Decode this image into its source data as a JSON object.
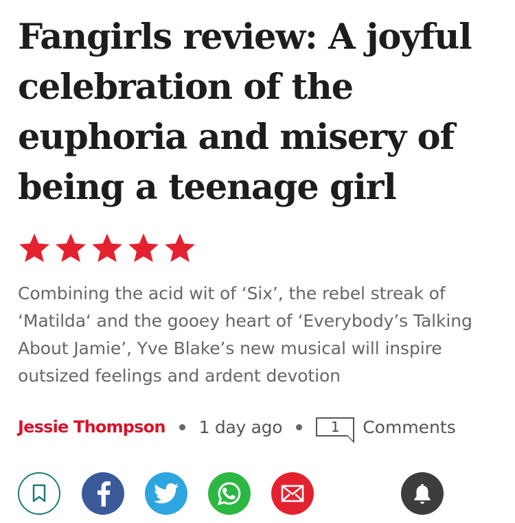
{
  "article": {
    "headline": "Fangirls review: A joyful celebration of the euphoria and misery of being a teenage girl",
    "rating": {
      "value": 5,
      "max": 5
    },
    "standfirst": "Combining the acid wit of ‘Six’, the rebel streak of ‘Matilda‘ and the gooey heart of ‘Everybody’s Talking About Jamie’, Yve Blake’s new musical will inspire outsized feelings and ardent devotion",
    "author": "Jessie Thompson",
    "published": "1 day ago",
    "comments_count": "1",
    "comments_label": "Comments"
  },
  "share": {
    "buttons": [
      {
        "name": "bookmark",
        "icon": "bookmark-icon",
        "color": "#1f7a74"
      },
      {
        "name": "facebook",
        "icon": "facebook-icon",
        "color": "#3b5a9a"
      },
      {
        "name": "twitter",
        "icon": "twitter-icon",
        "color": "#2da6e0"
      },
      {
        "name": "whatsapp",
        "icon": "whatsapp-icon",
        "color": "#2cb742"
      },
      {
        "name": "email",
        "icon": "envelope-icon",
        "color": "#e4212f"
      },
      {
        "name": "notifications",
        "icon": "bell-icon",
        "color": "#3d3d3d"
      }
    ]
  },
  "colors": {
    "accent": "#d6142a",
    "star": "#e4212f",
    "text": "#1d1d1b",
    "muted": "#666666"
  }
}
